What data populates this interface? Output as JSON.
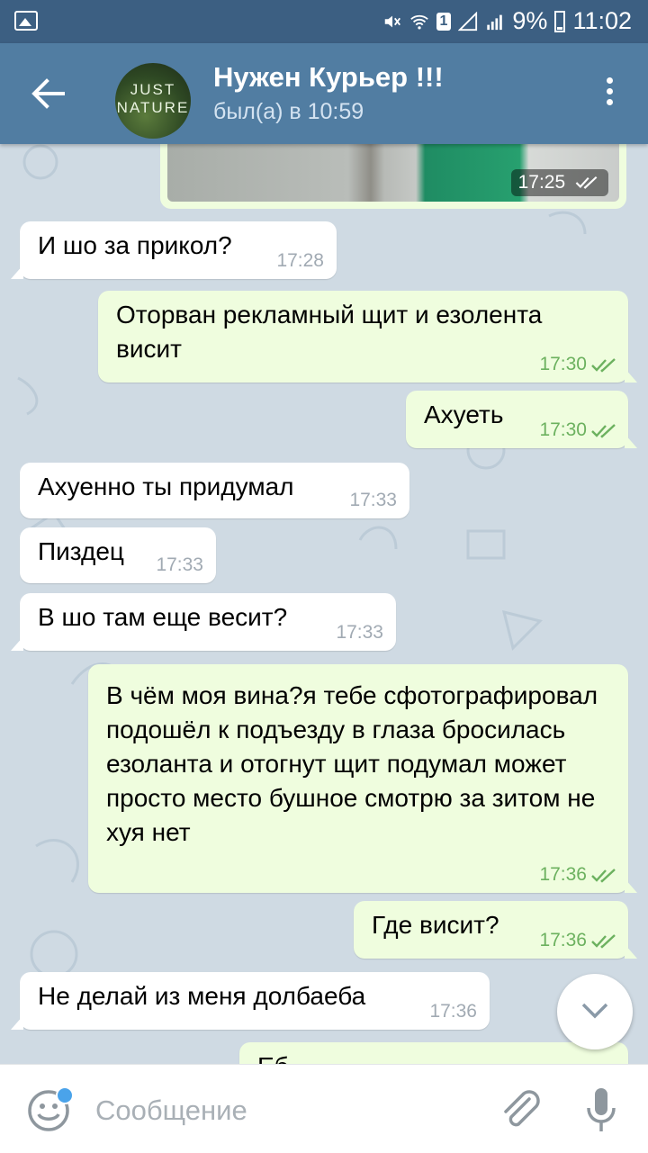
{
  "status_bar": {
    "battery": "9%",
    "time": "11:02",
    "sim_badge": "1"
  },
  "header": {
    "title": "Нужен Курьер !!!",
    "subtitle": "был(а) в 10:59",
    "avatar_text_line1": "JUST",
    "avatar_text_line2": "NATURE"
  },
  "messages": [
    {
      "direction": "out",
      "type": "photo",
      "time": "17:25",
      "read": true
    },
    {
      "direction": "in",
      "text": "И шо за прикол?",
      "time": "17:28"
    },
    {
      "direction": "out",
      "text": "Оторван рекламный щит и езолента висит",
      "time": "17:30",
      "read": true
    },
    {
      "direction": "out",
      "text": "Ахуеть",
      "time": "17:30",
      "read": true
    },
    {
      "direction": "in",
      "text": "Ахуенно ты придумал",
      "time": "17:33"
    },
    {
      "direction": "in",
      "text": "Пиздец",
      "time": "17:33"
    },
    {
      "direction": "in",
      "text": "В шо там еще весит?",
      "time": "17:33"
    },
    {
      "direction": "out",
      "text": "В чём моя вина?я тебе сфотографировал подошёл к подъезду в глаза бросилась езоланта и отогнут щит подумал может просто место бушное смотрю за зитом не хуя нет",
      "time": "17:36",
      "read": true
    },
    {
      "direction": "out",
      "text": "Где висит?",
      "time": "17:36",
      "read": true
    },
    {
      "direction": "in",
      "text": "Не делай из меня долбаеба",
      "time": "17:36"
    },
    {
      "direction": "out",
      "text": "Еб",
      "time": "",
      "read": false,
      "partial": true
    }
  ],
  "input": {
    "placeholder": "Сообщение",
    "value": ""
  },
  "icons": {
    "back": "arrow-left-icon",
    "menu": "more-vertical-icon",
    "emoji": "emoji-icon",
    "attach": "paperclip-icon",
    "mic": "microphone-icon",
    "scroll": "chevron-down-icon"
  },
  "colors": {
    "header": "#517da2",
    "status_bar": "#3c5f82",
    "outgoing_bubble": "#effdde",
    "incoming_bubble": "#ffffff",
    "chat_background": "#cfdae3",
    "read_check": "#6cb15f",
    "unread_dot": "#4aa3ea"
  }
}
